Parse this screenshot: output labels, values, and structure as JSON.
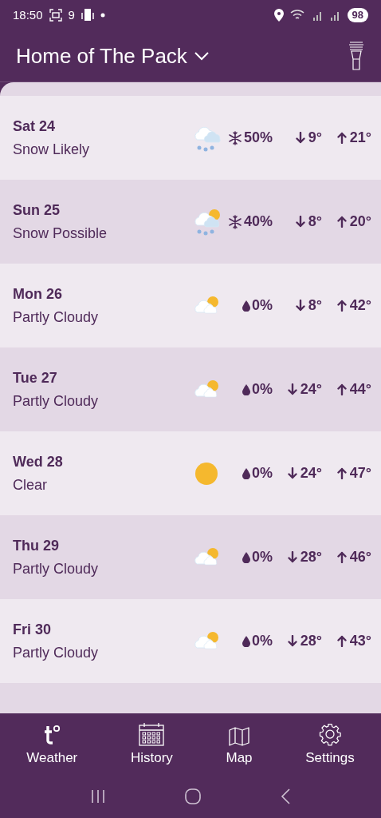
{
  "status_bar": {
    "time": "18:50",
    "notification_count": "9",
    "battery": "98"
  },
  "header": {
    "title": "Home of The Pack"
  },
  "forecast": [
    {
      "day": "Sat 24",
      "condition": "Snow Likely",
      "kind": "snow",
      "precip": "50%",
      "low": "9°",
      "high": "21°"
    },
    {
      "day": "Sun 25",
      "condition": "Snow Possible",
      "kind": "snowsun",
      "precip": "40%",
      "low": "8°",
      "high": "20°"
    },
    {
      "day": "Mon 26",
      "condition": "Partly Cloudy",
      "kind": "cloudy",
      "precip": "0%",
      "low": "8°",
      "high": "42°"
    },
    {
      "day": "Tue 27",
      "condition": "Partly Cloudy",
      "kind": "cloudy",
      "precip": "0%",
      "low": "24°",
      "high": "44°"
    },
    {
      "day": "Wed 28",
      "condition": "Clear",
      "kind": "clear",
      "precip": "0%",
      "low": "24°",
      "high": "47°"
    },
    {
      "day": "Thu 29",
      "condition": "Partly Cloudy",
      "kind": "cloudy",
      "precip": "0%",
      "low": "28°",
      "high": "46°"
    },
    {
      "day": "Fri 30",
      "condition": "Partly Cloudy",
      "kind": "cloudy",
      "precip": "0%",
      "low": "28°",
      "high": "43°"
    }
  ],
  "bottom_nav": [
    {
      "label": "Weather"
    },
    {
      "label": "History"
    },
    {
      "label": "Map"
    },
    {
      "label": "Settings"
    }
  ]
}
